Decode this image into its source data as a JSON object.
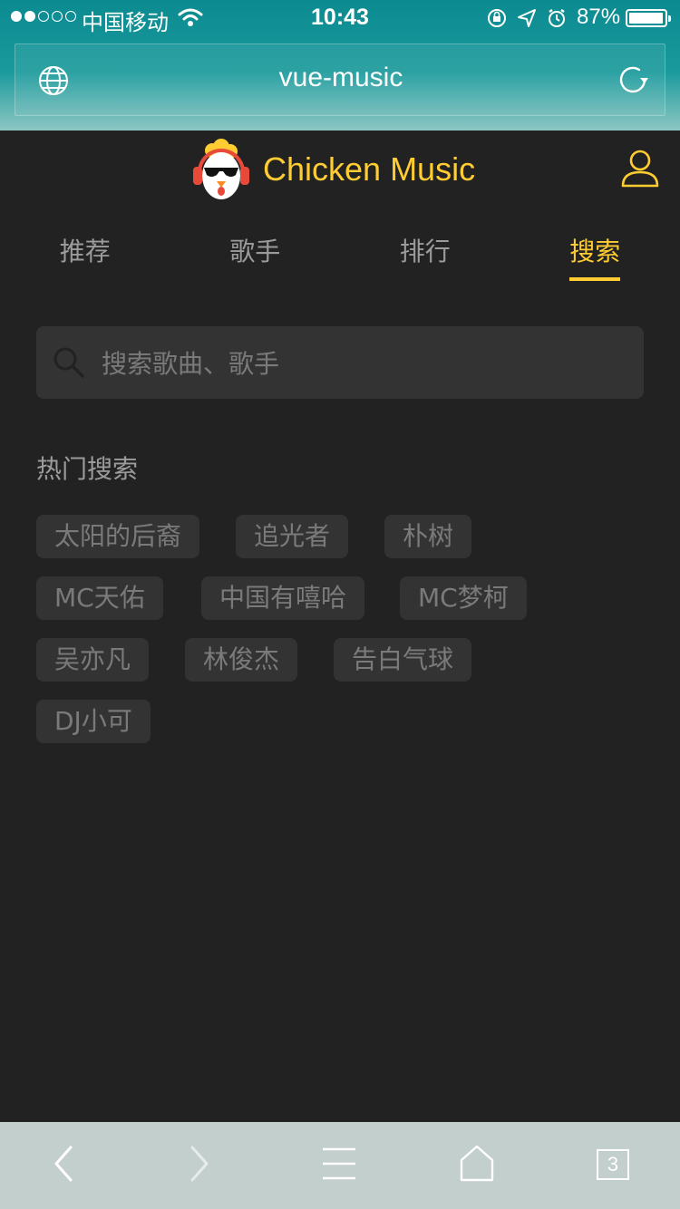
{
  "status_bar": {
    "carrier": "中国移动",
    "time": "10:43",
    "battery": "87%"
  },
  "browser": {
    "url": "vue-music",
    "tab_count": "3"
  },
  "app": {
    "brand": "Chicken Music",
    "accent_color": "#ffcd32",
    "tabs": [
      {
        "label": "推荐"
      },
      {
        "label": "歌手"
      },
      {
        "label": "排行"
      },
      {
        "label": "搜索"
      }
    ],
    "active_tab": "搜索"
  },
  "search": {
    "placeholder": "搜索歌曲、歌手",
    "value": ""
  },
  "hot": {
    "title": "热门搜索",
    "tags": [
      "太阳的后裔",
      "追光者",
      "朴树",
      "MC天佑",
      "中国有嘻哈",
      "MC梦柯",
      "吴亦凡",
      "林俊杰",
      "告白气球",
      "DJ小可"
    ]
  },
  "icons": {
    "globe": "globe-icon",
    "reload": "reload-icon",
    "user": "user-icon",
    "search": "search-icon",
    "back": "back-icon",
    "forward": "forward-icon",
    "menu": "menu-icon",
    "home": "home-icon"
  }
}
